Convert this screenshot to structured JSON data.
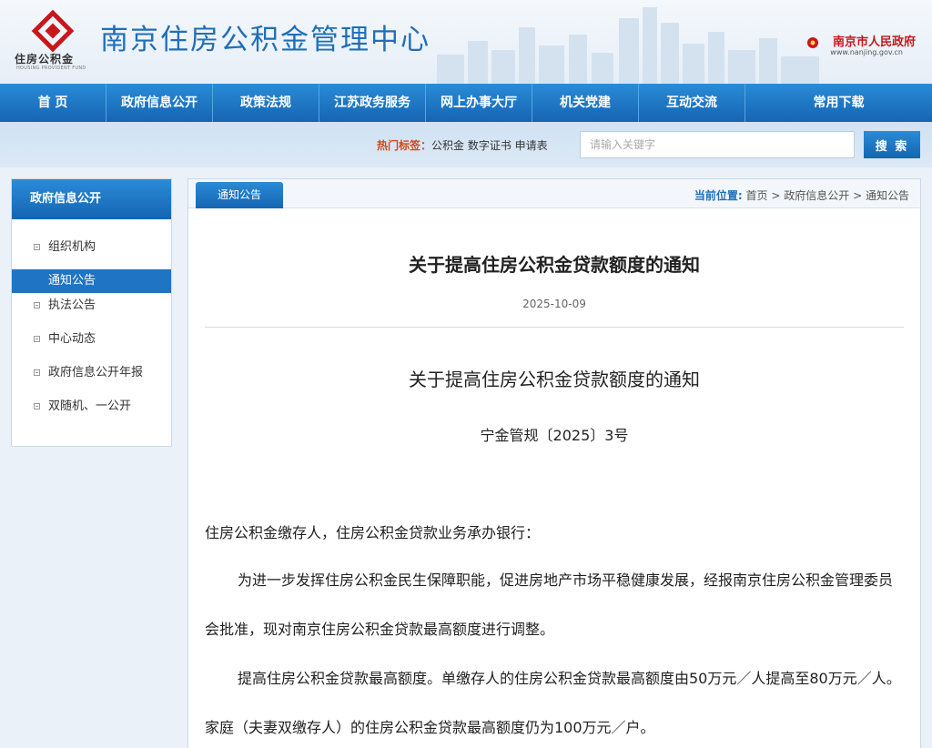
{
  "header": {
    "logo_text": "住房公积金",
    "logo_subtext": "HOUSING PROVIDENT FUND",
    "site_title": "南京住房公积金管理中心",
    "gov_name": "南京市人民政府",
    "gov_url": "www.nanjing.gov.cn"
  },
  "nav": {
    "items": [
      {
        "label": "首 页"
      },
      {
        "label": "政府信息公开"
      },
      {
        "label": "政策法规"
      },
      {
        "label": "江苏政务服务"
      },
      {
        "label": "网上办事大厅"
      },
      {
        "label": "机关党建"
      },
      {
        "label": "互动交流"
      },
      {
        "label": "常用下载"
      }
    ]
  },
  "search": {
    "hot_label": "热门标签：",
    "hot_words": "公积金 数字证书 申请表",
    "placeholder": "请输入关键字",
    "button_label": "搜 索"
  },
  "sidebar": {
    "title": "政府信息公开",
    "items": [
      {
        "label": "组织机构"
      },
      {
        "label": "通知公告"
      },
      {
        "label": "执法公告"
      },
      {
        "label": "中心动态"
      },
      {
        "label": "政府信息公开年报"
      },
      {
        "label": "双随机、一公开"
      }
    ],
    "active_index": 1
  },
  "content": {
    "tab_label": "通知公告",
    "breadcrumb": {
      "label": "当前位置:",
      "items": [
        "首页",
        "政府信息公开",
        "通知公告"
      ],
      "separator": ">"
    },
    "title": "关于提高住房公积金贷款额度的通知",
    "date": "2025-10-09",
    "doc_title": "关于提高住房公积金贷款额度的通知",
    "doc_number": "宁金管规〔2025〕3号",
    "paragraphs": [
      "住房公积金缴存人，住房公积金贷款业务承办银行：",
      "为进一步发挥住房公积金民生保障职能，促进房地产市场平稳健康发展，经报南京住房公积金管理委员会批准，现对南京住房公积金贷款最高额度进行调整。",
      "提高住房公积金贷款最高额度。单缴存人的住房公积金贷款最高额度由50万元／人提高至80万元／人。家庭（夫妻双缴存人）的住房公积金贷款最高额度仍为100万元／户。"
    ]
  },
  "colors": {
    "brand_blue": "#1f6fb8",
    "nav_blue": "#1565b3",
    "gov_red": "#c8161d",
    "logo_red": "#c8161d"
  }
}
